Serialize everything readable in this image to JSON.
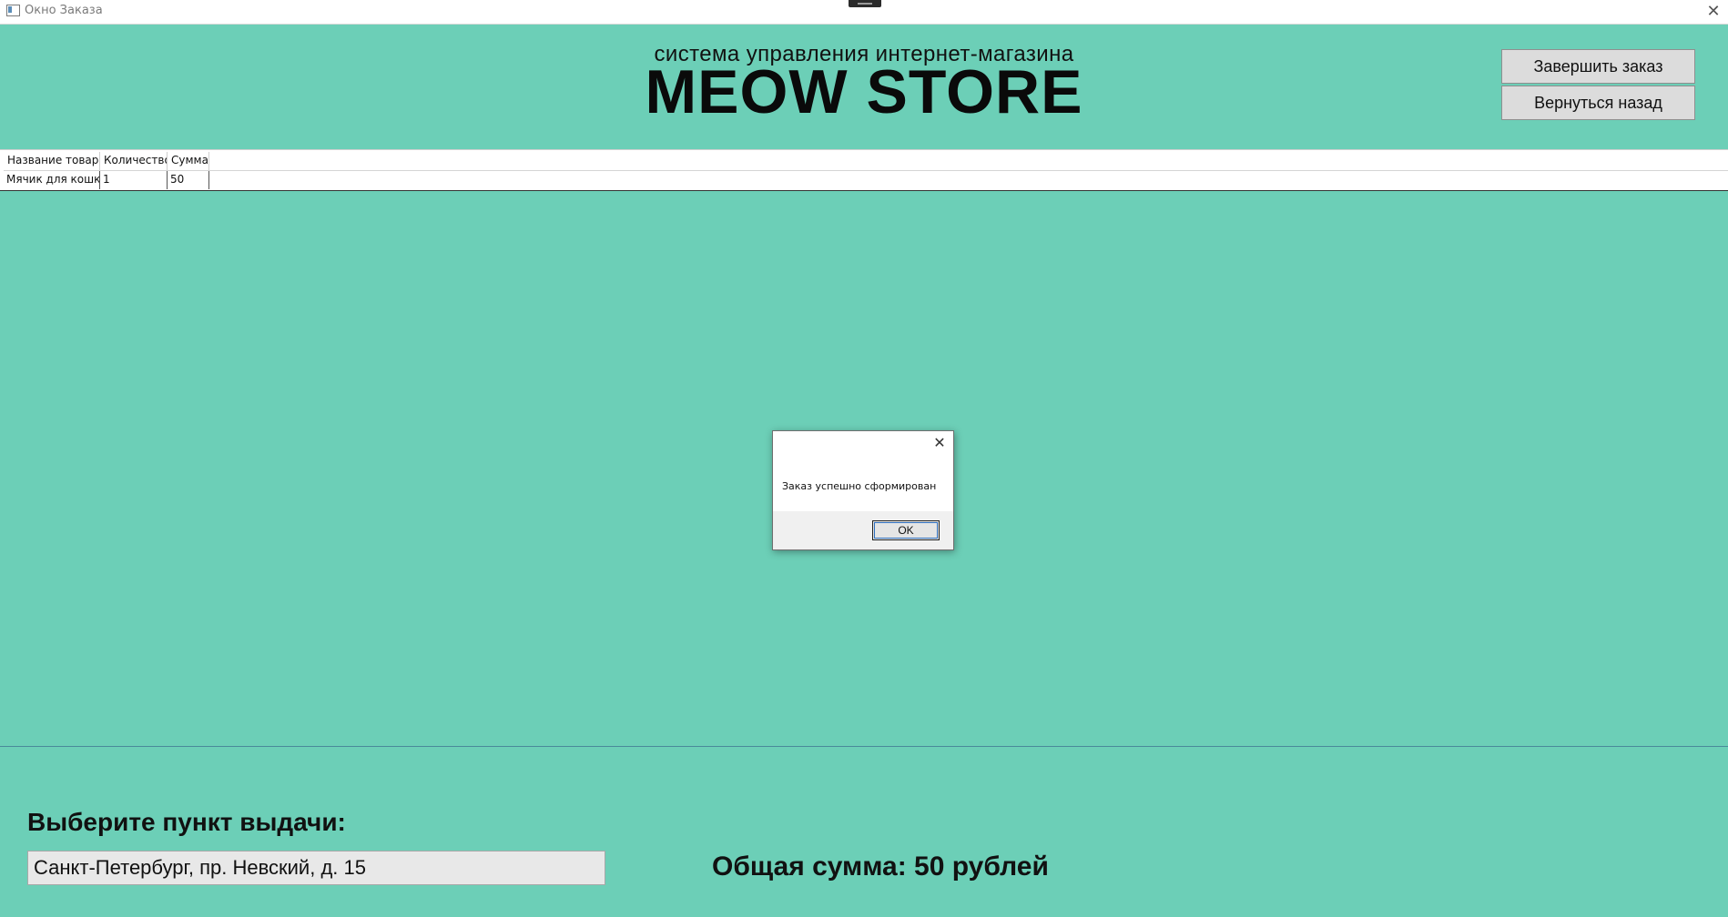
{
  "window": {
    "title": "Окно Заказа",
    "close_glyph": "✕"
  },
  "header": {
    "subtitle": "система управления интернет-магазина",
    "brand": "MEOW STORE"
  },
  "buttons": {
    "finish_order": "Завершить заказ",
    "go_back": "Вернуться назад"
  },
  "grid": {
    "columns": [
      "Название товара",
      "Количество",
      "Сумма"
    ],
    "rows": [
      [
        "Мячик для кошки",
        "1",
        "50"
      ]
    ]
  },
  "pickup": {
    "label": "Выберите пункт выдачи:",
    "selected": "Санкт-Петербург, пр. Невский, д. 15"
  },
  "total": "Общая сумма: 50 рублей",
  "dialog": {
    "message": "Заказ успешно сформирован",
    "ok_label": "OK",
    "close_glyph": "✕"
  },
  "colors": {
    "background": "#6ccfb7"
  }
}
